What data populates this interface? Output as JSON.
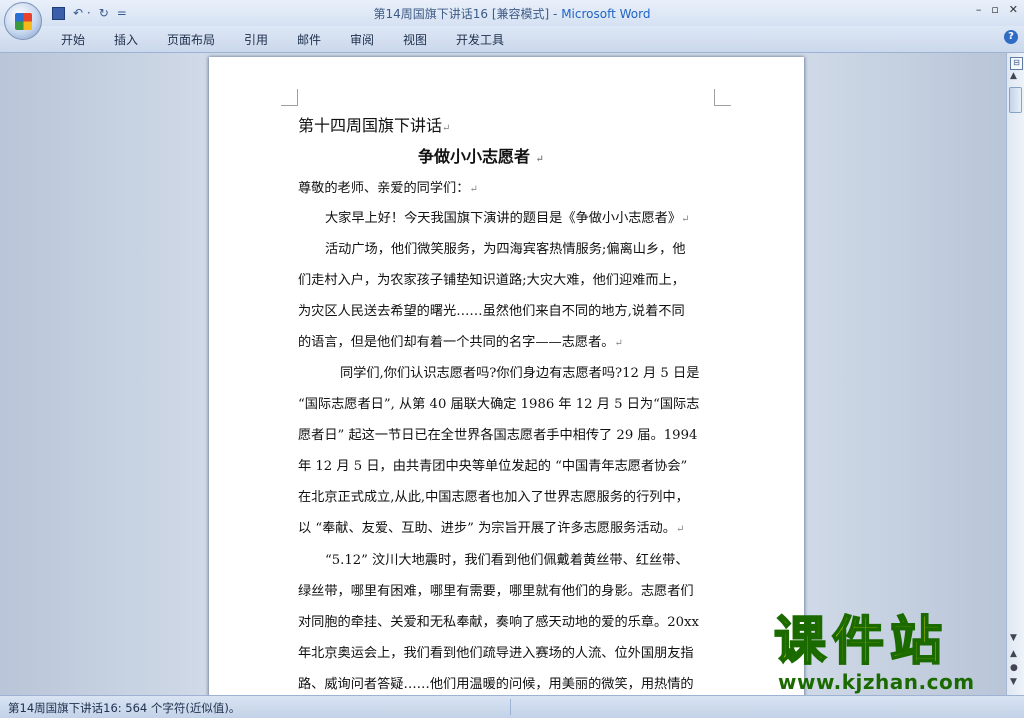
{
  "window": {
    "title_doc": "第14周国旗下讲话16 [兼容模式] - ",
    "title_app": "Microsoft Word",
    "minimize": "–",
    "restore": "▫",
    "close": "✕"
  },
  "quick_access": {
    "undo_label": "↶ ·",
    "redo_label": "↻",
    "customize_label": "="
  },
  "tabs": [
    "开始",
    "插入",
    "页面布局",
    "引用",
    "邮件",
    "审阅",
    "视图",
    "开发工具"
  ],
  "help_label": "?",
  "document": {
    "lines": [
      "第十四周国旗下讲话",
      "争做小小志愿者",
      "尊敬的老师、亲爱的同学们：",
      "大家早上好！今天我国旗下演讲的题目是《争做小小志愿者》",
      "活动广场，他们微笑服务，为四海宾客热情服务;偏离山乡，他",
      "们走村入户，为农家孩子铺垫知识道路;大灾大难，他们迎难而上，",
      "为灾区人民送去希望的曙光……虽然他们来自不同的地方,说着不同",
      "的语言，但是他们却有着一个共同的名字——志愿者。",
      "同学们,你们认识志愿者吗?你们身边有志愿者吗?12 月 5 日是",
      "“国际志愿者日”, 从第 40 届联大确定 1986 年 12 月 5 日为“国际志",
      "愿者日” 起这一节日已在全世界各国志愿者手中相传了 29 届。1994",
      "年 12 月 5 日，由共青团中央等单位发起的 “中国青年志愿者协会”",
      "在北京正式成立,从此,中国志愿者也加入了世界志愿服务的行列中，",
      "以 “奉献、友爱、互助、进步” 为宗旨开展了许多志愿服务活动。",
      "“5.12” 汶川大地震时，我们看到他们佩戴着黄丝带、红丝带、",
      "绿丝带，哪里有困难，哪里有需要，哪里就有他们的身影。志愿者们",
      "对同胞的牵挂、关爱和无私奉献，奏响了感天动地的爱的乐章。20xx",
      "年北京奥运会上，我们看到他们疏导进入赛场的人流、位外国朋友指",
      "路、威询问者答疑……他们用温暖的问候，用美丽的微笑，用热情的"
    ],
    "paragraph_mark": "↵"
  },
  "status": {
    "text": "第14周国旗下讲话16: 564 个字符(近似值)。"
  },
  "watermark": {
    "title": "课件站",
    "url": "www.kjzhan.com"
  }
}
